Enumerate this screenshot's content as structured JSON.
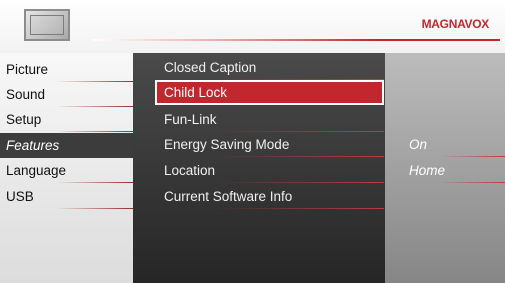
{
  "header": {
    "brand": "MAGNAVOX",
    "icon": "tv-icon"
  },
  "left_menu": {
    "items": [
      {
        "label": "Picture"
      },
      {
        "label": "Sound"
      },
      {
        "label": "Setup"
      },
      {
        "label": "Features",
        "active": true
      },
      {
        "label": "Language"
      },
      {
        "label": "USB"
      }
    ]
  },
  "features_menu": {
    "items": [
      {
        "label": "Closed Caption"
      },
      {
        "label": "Child Lock",
        "selected": true
      },
      {
        "label": "Fun-Link"
      },
      {
        "label": "Energy Saving Mode"
      },
      {
        "label": "Location"
      },
      {
        "label": "Current Software Info"
      }
    ]
  },
  "values": {
    "energy_saving_mode": "On",
    "location": "Home"
  },
  "colors": {
    "accent": "#c1272d",
    "active_left_bg": "#3c3c3c",
    "middle_panel": "#3a3a3a",
    "right_panel": "#a6a6a6"
  }
}
